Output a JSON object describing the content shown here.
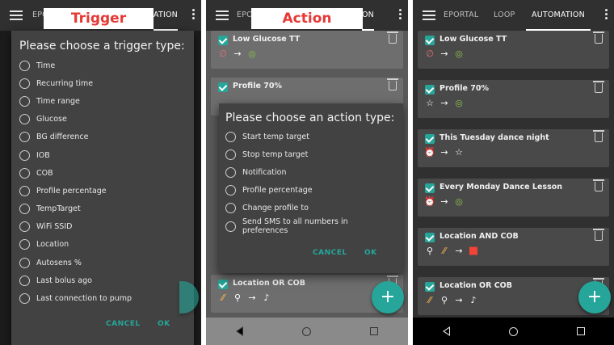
{
  "colors": {
    "accent": "#26a69a",
    "overlay_text": "#e53935"
  },
  "screen1": {
    "overlay_label": "Trigger",
    "tab_left": "EPO",
    "tab_right": "ATION",
    "dialog": {
      "title": "Please choose a trigger type:",
      "options": [
        "Time",
        "Recurring time",
        "Time range",
        "Glucose",
        "BG difference",
        "IOB",
        "COB",
        "Profile percentage",
        "TempTarget",
        "WiFi SSID",
        "Location",
        "Autosens %",
        "Last bolus ago",
        "Last connection to pump"
      ],
      "cancel": "CANCEL",
      "ok": "OK"
    }
  },
  "screen2": {
    "overlay_label": "Action",
    "tab_left": "EPO",
    "tab_right": "ON",
    "cards": [
      {
        "title": "Low Glucose TT"
      },
      {
        "title": "Profile 70%"
      },
      {
        "title": "Location OR COB"
      }
    ],
    "dialog": {
      "title": "Please choose an action type:",
      "options": [
        "Start temp target",
        "Stop temp target",
        "Notification",
        "Profile percentage",
        "Change profile to",
        "Send SMS to all numbers in preferences"
      ],
      "cancel": "CANCEL",
      "ok": "OK"
    },
    "fab": "+"
  },
  "screen3": {
    "tabs": [
      "EPORTAL",
      "LOOP",
      "AUTOMATION"
    ],
    "cards": [
      {
        "title": "Low Glucose TT"
      },
      {
        "title": "Profile 70%"
      },
      {
        "title": "This Tuesday dance night"
      },
      {
        "title": "Every Monday Dance Lesson"
      },
      {
        "title": "Location AND COB"
      },
      {
        "title": "Location OR COB"
      }
    ],
    "fab": "+"
  },
  "icons": {
    "arrow": "→",
    "star": "☆",
    "bell": "🔔",
    "alarm": "⏰",
    "pin": "⬤",
    "pill": "⁄⁄",
    "dot": "●"
  }
}
